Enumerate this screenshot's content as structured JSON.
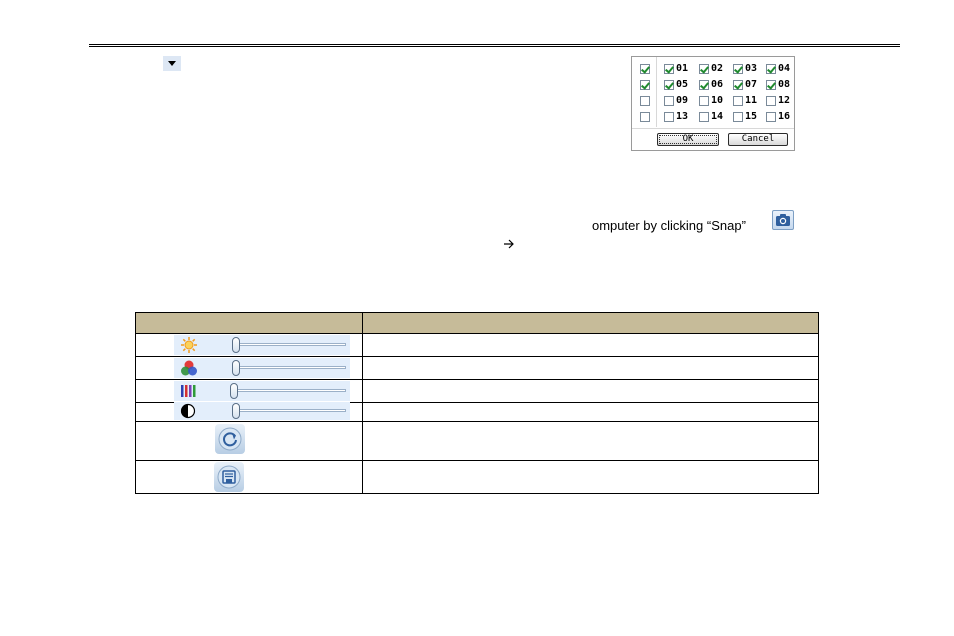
{
  "snap": {
    "text": "omputer by clicking “Snap”",
    "icon": "camera-icon"
  },
  "arrow": {
    "glyph": ""
  },
  "channels": {
    "all_row_checks": [
      true,
      true,
      false,
      false
    ],
    "rows": [
      [
        {
          "label": "01",
          "checked": true
        },
        {
          "label": "02",
          "checked": true
        },
        {
          "label": "03",
          "checked": true
        },
        {
          "label": "04",
          "checked": true
        }
      ],
      [
        {
          "label": "05",
          "checked": true
        },
        {
          "label": "06",
          "checked": true
        },
        {
          "label": "07",
          "checked": true
        },
        {
          "label": "08",
          "checked": true
        }
      ],
      [
        {
          "label": "09",
          "checked": false
        },
        {
          "label": "10",
          "checked": false
        },
        {
          "label": "11",
          "checked": false
        },
        {
          "label": "12",
          "checked": false
        }
      ],
      [
        {
          "label": "13",
          "checked": false
        },
        {
          "label": "14",
          "checked": false
        },
        {
          "label": "15",
          "checked": false
        },
        {
          "label": "16",
          "checked": false
        }
      ]
    ],
    "ok_label": "OK",
    "cancel_label": "Cancel"
  },
  "table": {
    "header": [
      "",
      ""
    ],
    "rows": [
      {
        "icon": "brightness-icon",
        "slider_level": 0
      },
      {
        "icon": "hue-icon",
        "slider_level": 0
      },
      {
        "icon": "saturation-icon",
        "slider_level": 0
      },
      {
        "icon": "contrast-icon",
        "slider_level": 0
      },
      {
        "icon": "reset-icon"
      },
      {
        "icon": "save-icon"
      }
    ]
  },
  "colors": {
    "header_bg": "#c6bb99",
    "check_green": "#1f8a2e",
    "slider_bg": "#e3eefb"
  }
}
